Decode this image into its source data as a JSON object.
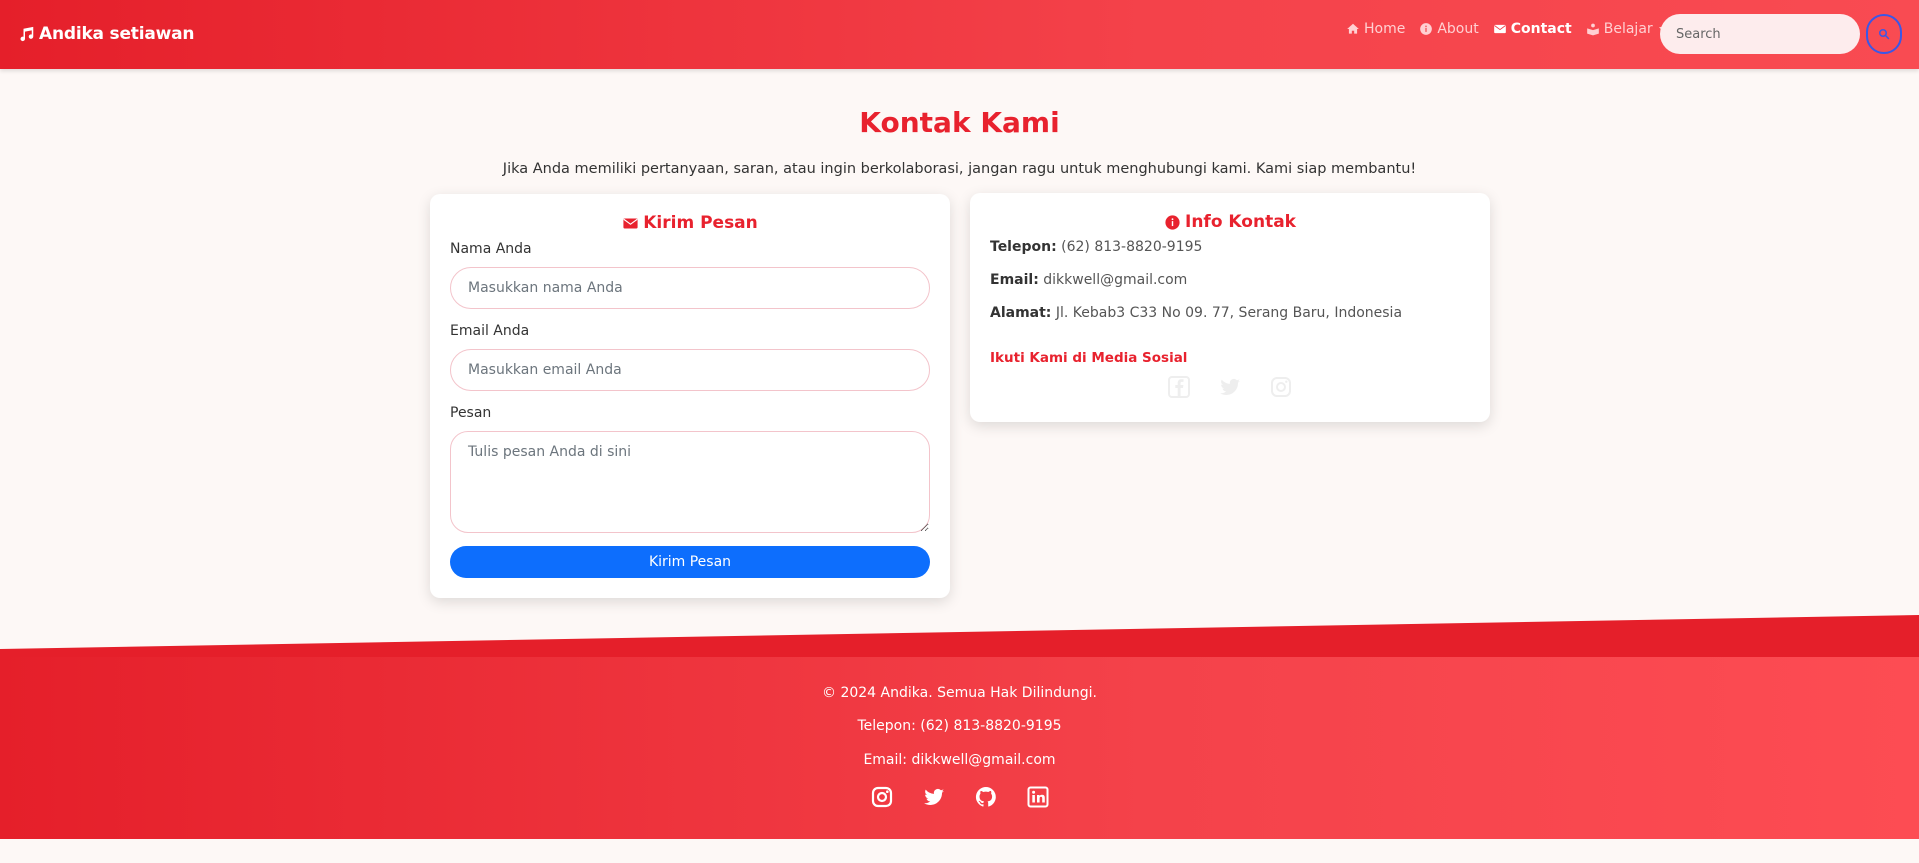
{
  "navbar": {
    "brand": "Andika setiawan",
    "links": {
      "home": "Home",
      "about": "About",
      "contact": "Contact",
      "belajar": "Belajar"
    },
    "search_placeholder": "Search"
  },
  "main": {
    "title": "Kontak Kami",
    "subtitle": "Jika Anda memiliki pertanyaan, saran, atau ingin berkolaborasi, jangan ragu untuk menghubungi kami. Kami siap membantu!"
  },
  "form": {
    "title": "Kirim Pesan",
    "name_label": "Nama Anda",
    "name_placeholder": "Masukkan nama Anda",
    "email_label": "Email Anda",
    "email_placeholder": "Masukkan email Anda",
    "message_label": "Pesan",
    "message_placeholder": "Tulis pesan Anda di sini",
    "submit_label": "Kirim Pesan"
  },
  "info": {
    "title": "Info Kontak",
    "phone_label": "Telepon:",
    "phone_value": "(62) 813-8820-9195",
    "email_label": "Email:",
    "email_value": "dikkwell@gmail.com",
    "address_label": "Alamat:",
    "address_value": "Jl. Kebab3 C33 No 09. 77, Serang Baru, Indonesia",
    "social_heading": "Ikuti Kami di Media Sosial",
    "social_icons": [
      "facebook-icon",
      "twitter-icon",
      "instagram-icon"
    ]
  },
  "footer": {
    "copyright": "© 2024 Andika. Semua Hak Dilindungi.",
    "phone": "Telepon: (62) 813-8820-9195",
    "email": "Email: dikkwell@gmail.com",
    "icons": [
      "instagram-icon",
      "twitter-icon",
      "github-icon",
      "linkedin-icon"
    ]
  },
  "colors": {
    "brand_red": "#e8222e",
    "nav_gradient_start": "#e51f2a",
    "nav_gradient_end": "#f94b52",
    "button_blue": "#0d6efd",
    "search_border": "#3a57e8"
  }
}
